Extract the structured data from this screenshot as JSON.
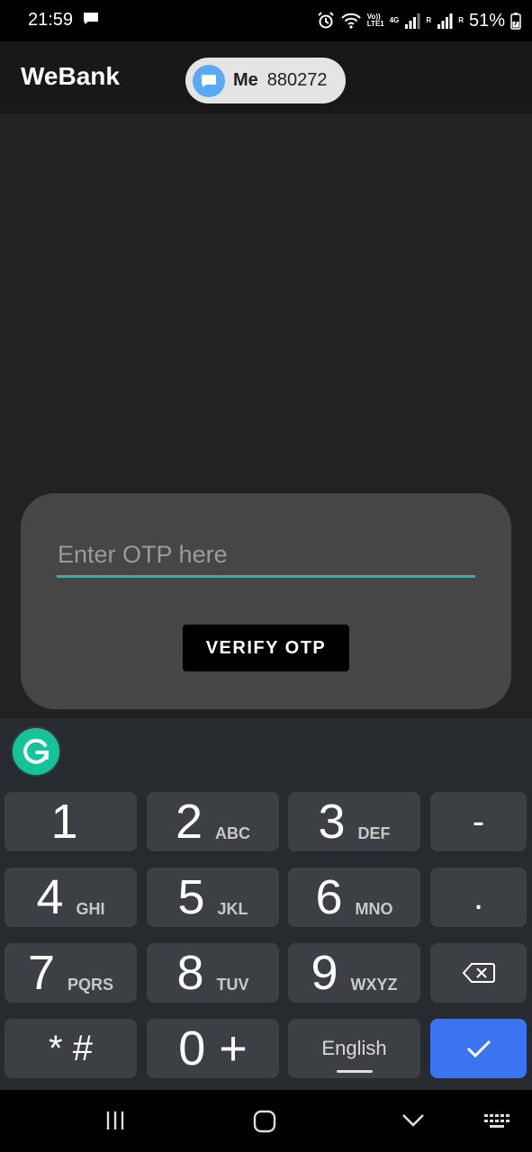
{
  "status_bar": {
    "time": "21:59",
    "volte_label": "Vo))\nLTE1",
    "net_label": "4G",
    "roaming_label_1": "R",
    "roaming_label_2": "R",
    "battery": "51%"
  },
  "app_bar": {
    "title": "WeBank",
    "notification": {
      "sender": "Me",
      "code": "880272"
    }
  },
  "otp_card": {
    "placeholder": "Enter OTP here",
    "verify_label": "VERIFY OTP",
    "accent": "#26b8a6"
  },
  "keyboard": {
    "rows": [
      [
        {
          "digit": "1",
          "letters": ""
        },
        {
          "digit": "2",
          "letters": "ABC"
        },
        {
          "digit": "3",
          "letters": "DEF"
        },
        {
          "digit": "-",
          "letters": ""
        }
      ],
      [
        {
          "digit": "4",
          "letters": "GHI"
        },
        {
          "digit": "5",
          "letters": "JKL"
        },
        {
          "digit": "6",
          "letters": "MNO"
        },
        {
          "digit": ".",
          "letters": ""
        }
      ],
      [
        {
          "digit": "7",
          "letters": "PQRS"
        },
        {
          "digit": "8",
          "letters": "TUV"
        },
        {
          "digit": "9",
          "letters": "WXYZ"
        },
        {
          "digit": "",
          "letters": ""
        }
      ],
      [
        {
          "digit": "* #",
          "letters": ""
        },
        {
          "digit": "0 +",
          "letters": ""
        },
        {
          "digit": "English",
          "letters": ""
        },
        {
          "digit": "",
          "letters": ""
        }
      ]
    ],
    "language": "English",
    "done_color": "#3a74f0"
  }
}
